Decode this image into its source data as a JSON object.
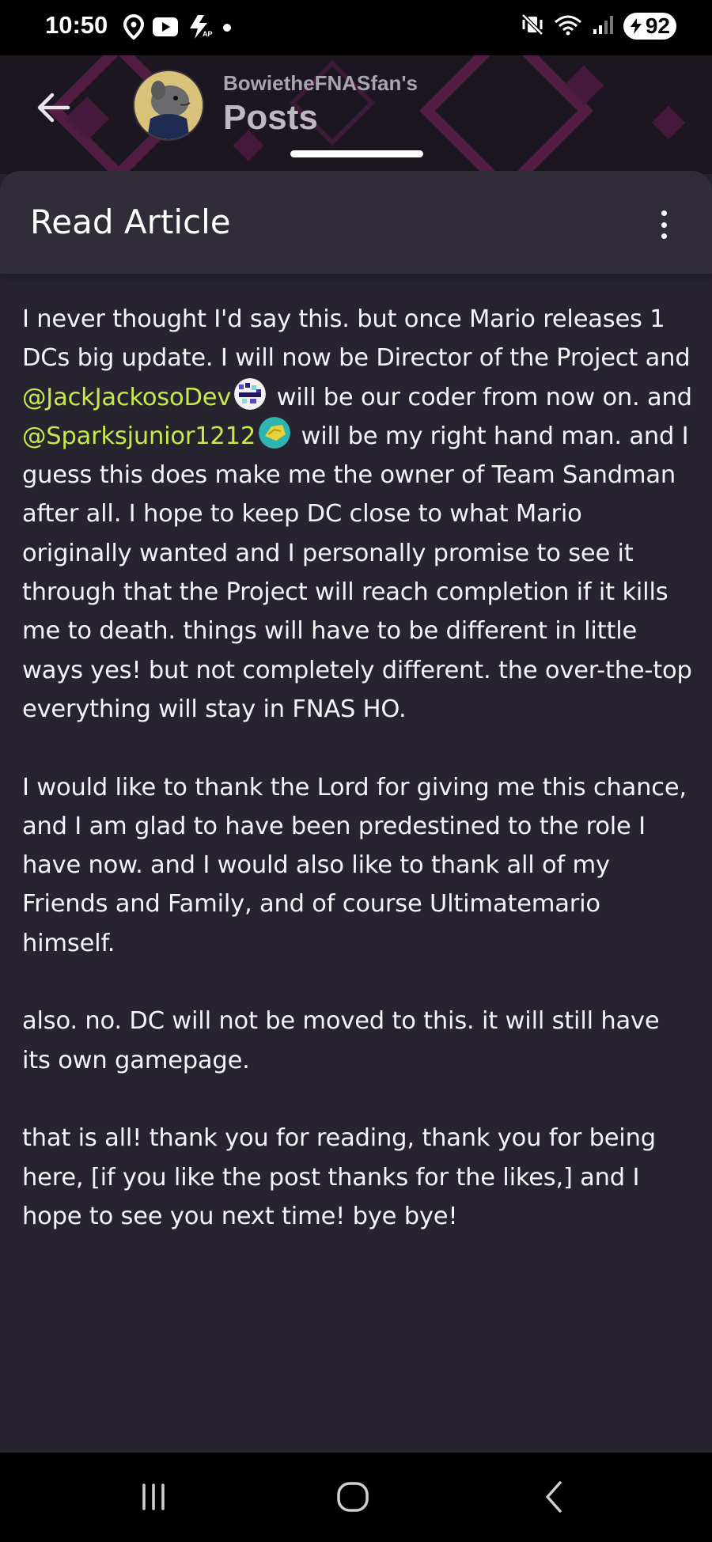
{
  "status_bar": {
    "time": "10:50",
    "battery": "92",
    "left_icons": [
      "location-icon",
      "youtube-icon",
      "bolt-icon",
      "dot-icon"
    ],
    "right_icons": [
      "mute-vibrate-icon",
      "wifi-icon",
      "signal-icon",
      "battery-icon"
    ]
  },
  "header": {
    "subtitle": "BowietheFNASfan's",
    "title": "Posts"
  },
  "sheet": {
    "title": "Read Article"
  },
  "article": {
    "p1": {
      "t1": "I never thought I'd say this. but once Mario releases 1 DCs big update. I will now be Director of the Project and ",
      "mention1": "@JackJackosoDev",
      "t2": " will be our coder from now on. and ",
      "mention2": "@Sparksjunior1212",
      "t3": " will be my right hand man. and I guess this does make me the owner of Team Sandman after all. I hope to keep DC close to what Mario originally wanted and I personally promise to see it through that the Project will reach completion if it kills me to death. things will have to be different in little ways yes! but not completely different. the over-the-top everything will stay in FNAS HO."
    },
    "p2": "I would like to thank the Lord for giving me this chance, and I am glad to have been predestined to the role I have now. and I would also like to thank all of my Friends and Family, and of course Ultimatemario himself.",
    "p3": "also. no. DC will not be moved to this. it will still have its own gamepage.",
    "p4": "that is all! thank you for reading, thank you for being here, [if you like the post thanks for the likes,] and I hope to see you next time! bye bye!"
  },
  "colors": {
    "background": "#27242f",
    "mention": "#c6e94b",
    "header_bg": "#1b1620"
  },
  "nav_bar": {
    "buttons": [
      "recents-icon",
      "home-icon",
      "back-icon"
    ]
  }
}
